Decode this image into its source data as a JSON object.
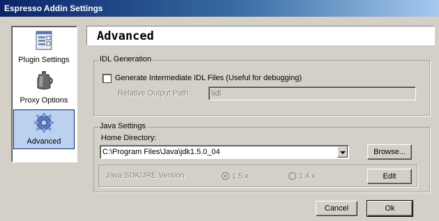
{
  "window": {
    "title": "Espresso Addin Settings"
  },
  "nav": {
    "items": [
      {
        "label": "Plugin Settings",
        "icon": "settings-panel-icon",
        "selected": false
      },
      {
        "label": "Proxy Options",
        "icon": "coffee-pot-icon",
        "selected": false
      },
      {
        "label": "Advanced",
        "icon": "gear-icon",
        "selected": true
      }
    ]
  },
  "page": {
    "title": "Advanced"
  },
  "idl": {
    "group_label": "IDL Generation",
    "generate_label": "Generate Intermediate IDL Files (Useful for debugging)",
    "generate_checked": false,
    "output_path_label": "Relative Output Path",
    "output_path_value": "\\idl"
  },
  "java": {
    "group_label": "Java Settings",
    "home_label": "Home Directory:",
    "home_value": "C:\\Program Files\\Java\\jdk1.5.0_04",
    "browse_label": "Browse...",
    "version_label": "Java SDK/JRE Version",
    "options": [
      {
        "label": "1.5.x",
        "selected": true
      },
      {
        "label": "1.4.x",
        "selected": false
      }
    ],
    "edit_label": "Edit"
  },
  "footer": {
    "cancel_label": "Cancel",
    "ok_label": "Ok"
  },
  "colors": {
    "titlebar_start": "#0a246a",
    "titlebar_end": "#a6caf0",
    "dialog_bg": "#d4d0c8",
    "selection": "#bcd1ee"
  }
}
